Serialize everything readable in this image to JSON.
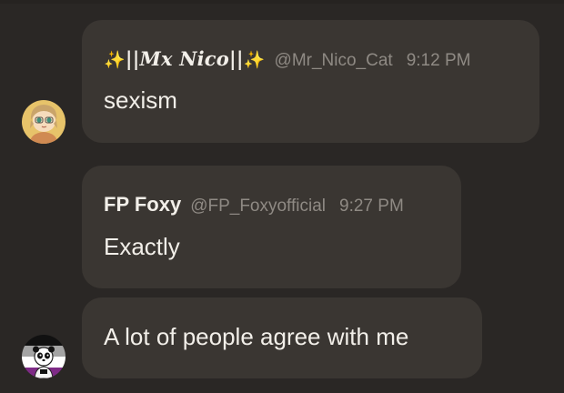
{
  "messages": [
    {
      "display_name": "||Mx Nico||",
      "display_name_prefix": "✨",
      "display_name_suffix": "✨",
      "handle": "@Mr_Nico_Cat",
      "time": "9:12 PM",
      "text": "sexism",
      "avatar": "anime-character-avatar"
    },
    {
      "display_name": "FP Foxy",
      "handle": "@FP_Foxyofficial",
      "time": "9:27 PM",
      "text": "Exactly"
    },
    {
      "text": "A lot of people agree with me",
      "avatar": "asexual-flag-panda-avatar"
    }
  ],
  "colors": {
    "background": "#2a2725",
    "bubble": "#3a3632",
    "text": "#f2efe9",
    "muted": "#8f8a84",
    "sparkle": "#f7c531"
  }
}
